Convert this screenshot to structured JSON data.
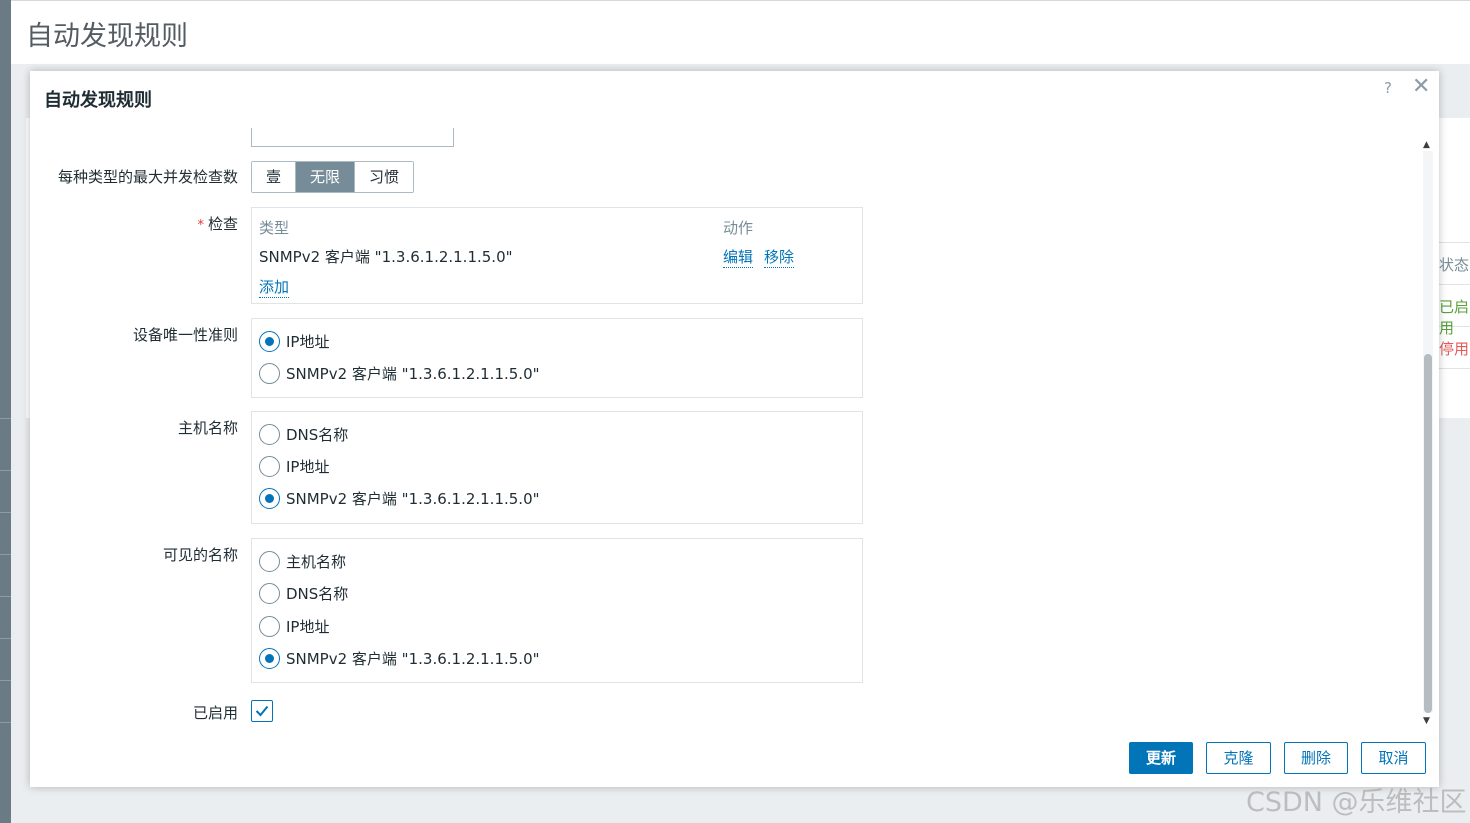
{
  "page": {
    "title": "自动发现规则"
  },
  "background": {
    "col_status": "状态",
    "status_enabled": "已启用",
    "status_disabled": "停用"
  },
  "dialog": {
    "title": "自动发现规则",
    "help_icon": "?",
    "close_icon": "✕",
    "fields": {
      "max_concurrent": {
        "label": "每种类型的最大并发检查数",
        "options": [
          "壹",
          "无限",
          "习惯"
        ],
        "selected": "无限"
      },
      "checks": {
        "label": "检查",
        "required_mark": "*",
        "col_type": "类型",
        "col_action": "动作",
        "rows": [
          {
            "type": "SNMPv2 客户端 \"1.3.6.1.2.1.1.5.0\"",
            "edit": "编辑",
            "remove": "移除"
          }
        ],
        "add": "添加"
      },
      "uniqueness": {
        "label": "设备唯一性准则",
        "options": [
          "IP地址",
          "SNMPv2 客户端 \"1.3.6.1.2.1.1.5.0\""
        ],
        "selected_index": 0
      },
      "host_name": {
        "label": "主机名称",
        "options": [
          "DNS名称",
          "IP地址",
          "SNMPv2 客户端 \"1.3.6.1.2.1.1.5.0\""
        ],
        "selected_index": 2
      },
      "visible_name": {
        "label": "可见的名称",
        "options": [
          "主机名称",
          "DNS名称",
          "IP地址",
          "SNMPv2 客户端 \"1.3.6.1.2.1.1.5.0\""
        ],
        "selected_index": 3
      },
      "enabled": {
        "label": "已启用",
        "checked": true
      }
    },
    "buttons": {
      "update": "更新",
      "clone": "克隆",
      "delete": "删除",
      "cancel": "取消"
    }
  },
  "watermark": "CSDN @乐维社区",
  "colors": {
    "primary": "#0275b8",
    "selected_segment": "#768d99",
    "border": "#dfe4e7",
    "text": "#1f2c33"
  }
}
